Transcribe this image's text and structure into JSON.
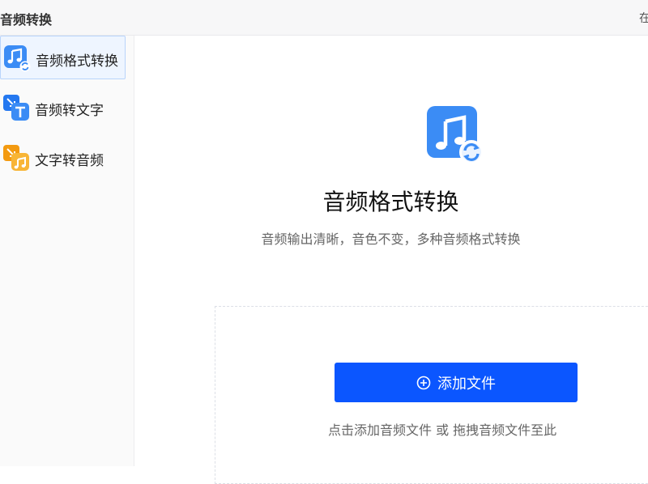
{
  "window": {
    "app_title": "音频转换",
    "right_text": "在"
  },
  "sidebar": {
    "items": [
      {
        "label": "音频格式转换",
        "icon": "music-convert-icon",
        "active": true
      },
      {
        "label": "音频转文字",
        "icon": "audio-to-text-icon",
        "active": false
      },
      {
        "label": "文字转音频",
        "icon": "text-to-audio-icon",
        "active": false
      }
    ]
  },
  "main": {
    "icon": "music-convert-icon",
    "title": "音频格式转换",
    "subtitle": "音频输出清晰，音色不变，多种音频格式转换",
    "add_button_label": "添加文件",
    "drop_hint": "点击添加音频文件 或 拖拽音频文件至此"
  },
  "colors": {
    "accent": "#0b56ff",
    "active_bg": "#eef5ff",
    "icon_blue": "#3b8cf5",
    "icon_orange": "#f6a21a"
  }
}
